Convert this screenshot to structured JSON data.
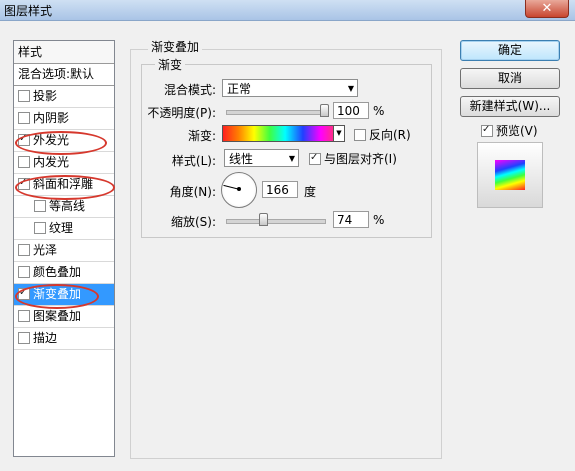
{
  "window": {
    "title": "图层样式",
    "close_label": "✕"
  },
  "stylelist": {
    "header": "样式",
    "blend_row": "混合选项:默认",
    "items": [
      {
        "label": "投影",
        "checked": false
      },
      {
        "label": "内阴影",
        "checked": false
      },
      {
        "label": "外发光",
        "checked": true
      },
      {
        "label": "内发光",
        "checked": false
      },
      {
        "label": "斜面和浮雕",
        "checked": true
      },
      {
        "label": "等高线",
        "checked": false
      },
      {
        "label": "纹理",
        "checked": false
      },
      {
        "label": "光泽",
        "checked": false
      },
      {
        "label": "颜色叠加",
        "checked": false
      },
      {
        "label": "渐变叠加",
        "checked": true
      },
      {
        "label": "图案叠加",
        "checked": false
      },
      {
        "label": "描边",
        "checked": false
      }
    ]
  },
  "panel": {
    "group_title": "渐变叠加",
    "inner_title": "渐变",
    "blend_mode_label": "混合模式:",
    "blend_mode_value": "正常",
    "opacity_label": "不透明度(P):",
    "opacity_value": "100",
    "percent": "%",
    "gradient_label": "渐变:",
    "reverse_label": "反向(R)",
    "style_label": "样式(L):",
    "style_value": "线性",
    "align_label": "与图层对齐(I)",
    "angle_label": "角度(N):",
    "angle_value": "166",
    "angle_unit": "度",
    "scale_label": "缩放(S):",
    "scale_value": "74",
    "opacity_level_percent": 100,
    "scale_level_percent": 74
  },
  "buttons": {
    "ok": "确定",
    "cancel": "取消",
    "new_style": "新建样式(W)...",
    "preview_label": "预览(V)"
  }
}
